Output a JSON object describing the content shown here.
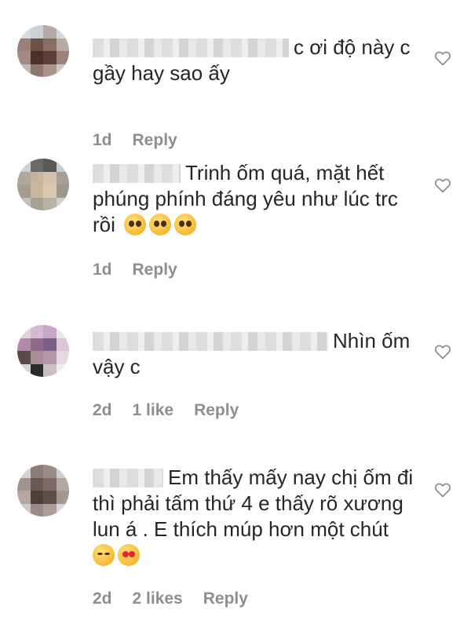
{
  "comments": [
    {
      "text": "c ơi độ này c gầy hay sao ấy",
      "time": "1d",
      "likes": "",
      "reply": "Reply"
    },
    {
      "text": "Trinh ốm quá, mặt hết phúng phính đáng yêu như lúc trc rồi",
      "emojis": [
        "pleading-face",
        "pleading-face",
        "pleading-face"
      ],
      "time": "1d",
      "likes": "",
      "reply": "Reply"
    },
    {
      "text": "Nhìn ốm vậy c",
      "time": "2d",
      "likes": "1 like",
      "reply": "Reply"
    },
    {
      "text": "Em thấy mấy nay chị ốm đi thì phải tấm thứ 4 e thấy rõ xương lun á . E thích múp hơn một chút",
      "emojis": [
        "relieved-face",
        "heart-eyes-face"
      ],
      "time": "2d",
      "likes": "2 likes",
      "reply": "Reply"
    }
  ],
  "colors": {
    "text": "#262626",
    "meta": "#8e8e8e",
    "heart_stroke": "#8e8e8e"
  }
}
